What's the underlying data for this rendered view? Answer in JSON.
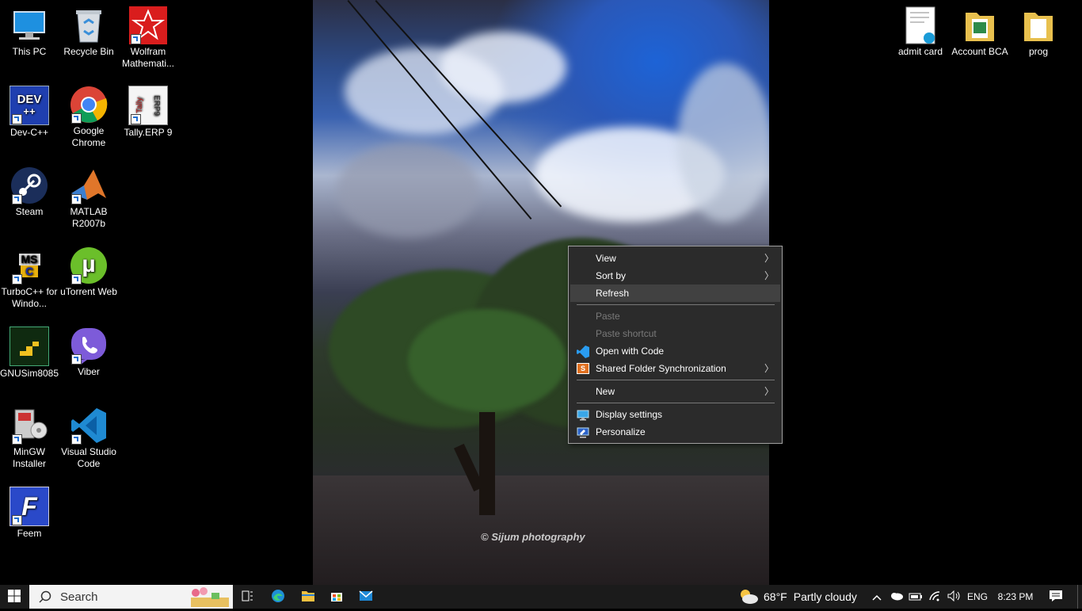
{
  "desktop": {
    "left_icons": [
      {
        "label": "This PC"
      },
      {
        "label": "Recycle Bin"
      },
      {
        "label": "Wolfram Mathemati..."
      },
      {
        "label": "Dev-C++"
      },
      {
        "label": "Google Chrome"
      },
      {
        "label": "Tally.ERP 9"
      },
      {
        "label": "Steam"
      },
      {
        "label": "MATLAB R2007b"
      },
      {
        "label": "TurboC++ for Windo..."
      },
      {
        "label": "uTorrent Web"
      },
      {
        "label": "GNUSim8085"
      },
      {
        "label": "Viber"
      },
      {
        "label": "MinGW Installer"
      },
      {
        "label": "Visual Studio Code"
      },
      {
        "label": "Feem"
      }
    ],
    "right_icons": [
      {
        "label": "admit card"
      },
      {
        "label": "Account BCA"
      },
      {
        "label": "prog"
      }
    ],
    "icon_art": {
      "dev": "DEV",
      "dev_plus": "++",
      "tally": "Tally",
      "tally_erp": "ERP9",
      "turbo": "MS",
      "turbo_c": "C",
      "feem": "F",
      "utorrent": "µ"
    },
    "watermark": "© Sijum photography"
  },
  "context_menu": {
    "items": [
      {
        "label": "View",
        "submenu": true,
        "enabled": true
      },
      {
        "label": "Sort by",
        "submenu": true,
        "enabled": true
      },
      {
        "label": "Refresh",
        "submenu": false,
        "enabled": true,
        "highlighted": true
      },
      {
        "label": "Paste",
        "enabled": false
      },
      {
        "label": "Paste shortcut",
        "enabled": false
      },
      {
        "label": "Open with Code",
        "enabled": true,
        "icon": "vscode-icon"
      },
      {
        "label": "Shared Folder Synchronization",
        "submenu": true,
        "enabled": true,
        "icon": "sync-icon"
      },
      {
        "label": "New",
        "submenu": true,
        "enabled": true
      },
      {
        "label": "Display settings",
        "enabled": true,
        "icon": "display-icon"
      },
      {
        "label": "Personalize",
        "enabled": true,
        "icon": "personalize-icon"
      }
    ],
    "submenu_glyph": "〉",
    "sync_glyph": "S"
  },
  "taskbar": {
    "search_placeholder": "Search",
    "weather_temp": "68°F",
    "weather_desc": "Partly cloudy",
    "language": "ENG",
    "time": "8:23 PM",
    "pinned": [
      "task-view-icon",
      "edge-icon",
      "file-explorer-icon",
      "store-icon",
      "mail-icon"
    ]
  },
  "colors": {
    "menu_bg": "#2b2b2b",
    "menu_highlight": "#414141",
    "taskbar_bg": "#1b1b1b",
    "accent": "#1f6fd1"
  }
}
